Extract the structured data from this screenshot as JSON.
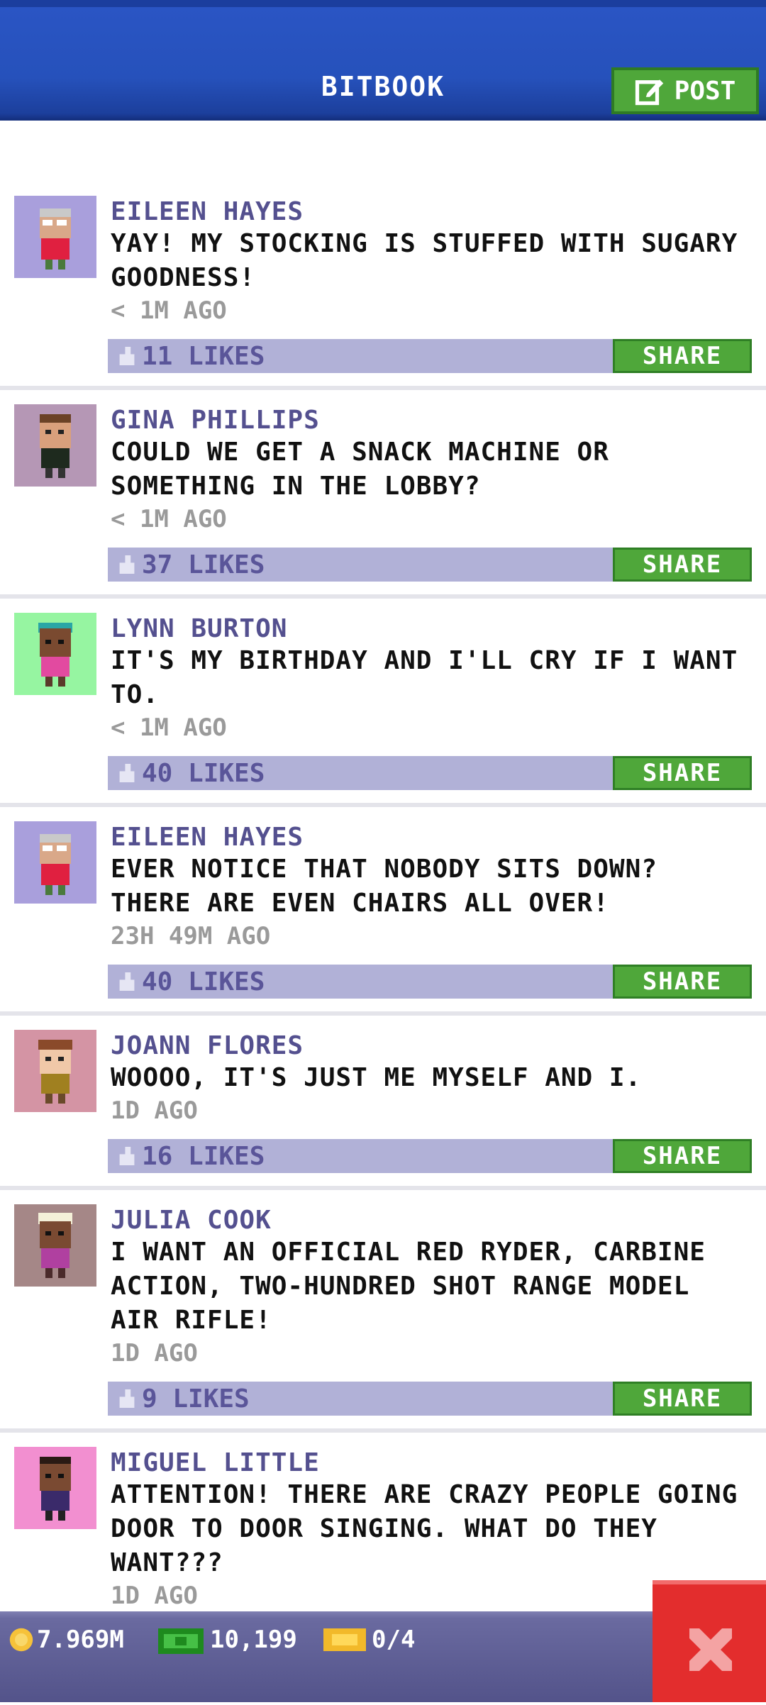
{
  "app": {
    "title": "BITBOOK",
    "post_label": "POST"
  },
  "posts": [
    {
      "name": "EILEEN HAYES",
      "text": "YAY! MY STOCKING IS STUFFED WITH SUGARY GOODNESS!",
      "time": "< 1M AGO",
      "likes": "11 LIKES",
      "share": "SHARE",
      "avatar_bg": "#a99fdc"
    },
    {
      "name": "GINA PHILLIPS",
      "text": "COULD WE GET A SNACK MACHINE OR SOMETHING IN THE LOBBY?",
      "time": "< 1M AGO",
      "likes": "37 LIKES",
      "share": "SHARE",
      "avatar_bg": "#b597b5"
    },
    {
      "name": "LYNN BURTON",
      "text": "IT'S MY BIRTHDAY AND I'LL CRY IF I WANT TO.",
      "time": "< 1M AGO",
      "likes": "40 LIKES",
      "share": "SHARE",
      "avatar_bg": "#96f5a1"
    },
    {
      "name": "EILEEN HAYES",
      "text": "EVER NOTICE THAT NOBODY SITS DOWN? THERE ARE EVEN CHAIRS ALL OVER!",
      "time": "23H 49M AGO",
      "likes": "40 LIKES",
      "share": "SHARE",
      "avatar_bg": "#a99fdc"
    },
    {
      "name": "JOANN FLORES",
      "text": "WOOOO, IT'S JUST ME MYSELF AND I.",
      "time": "1D AGO",
      "likes": "16 LIKES",
      "share": "SHARE",
      "avatar_bg": "#d494a4"
    },
    {
      "name": "JULIA COOK",
      "text": "I WANT AN OFFICIAL RED RYDER, CARBINE ACTION, TWO-HUNDRED SHOT RANGE MODEL AIR RIFLE!",
      "time": "1D AGO",
      "likes": "9 LIKES",
      "share": "SHARE",
      "avatar_bg": "#a58787"
    },
    {
      "name": "MIGUEL LITTLE",
      "text": "ATTENTION! THERE ARE CRAZY PEOPLE GOING DOOR TO DOOR SINGING. WHAT DO THEY WANT???",
      "time": "1D AGO",
      "avatar_bg": "#f28fd0"
    }
  ],
  "footer": {
    "coins": "7.969M",
    "bux": "10,199",
    "tickets": "0/4"
  },
  "colors": {
    "header": "#2651bb",
    "accent_green": "#4fa73a",
    "like_bar": "#b1b1d7",
    "close_red": "#e32d2d"
  },
  "icons": {
    "post": "edit-icon",
    "like": "thumb-up-icon",
    "coins": "coin-icon",
    "bux": "bux-icon",
    "tickets": "ticket-icon",
    "close": "close-icon"
  }
}
